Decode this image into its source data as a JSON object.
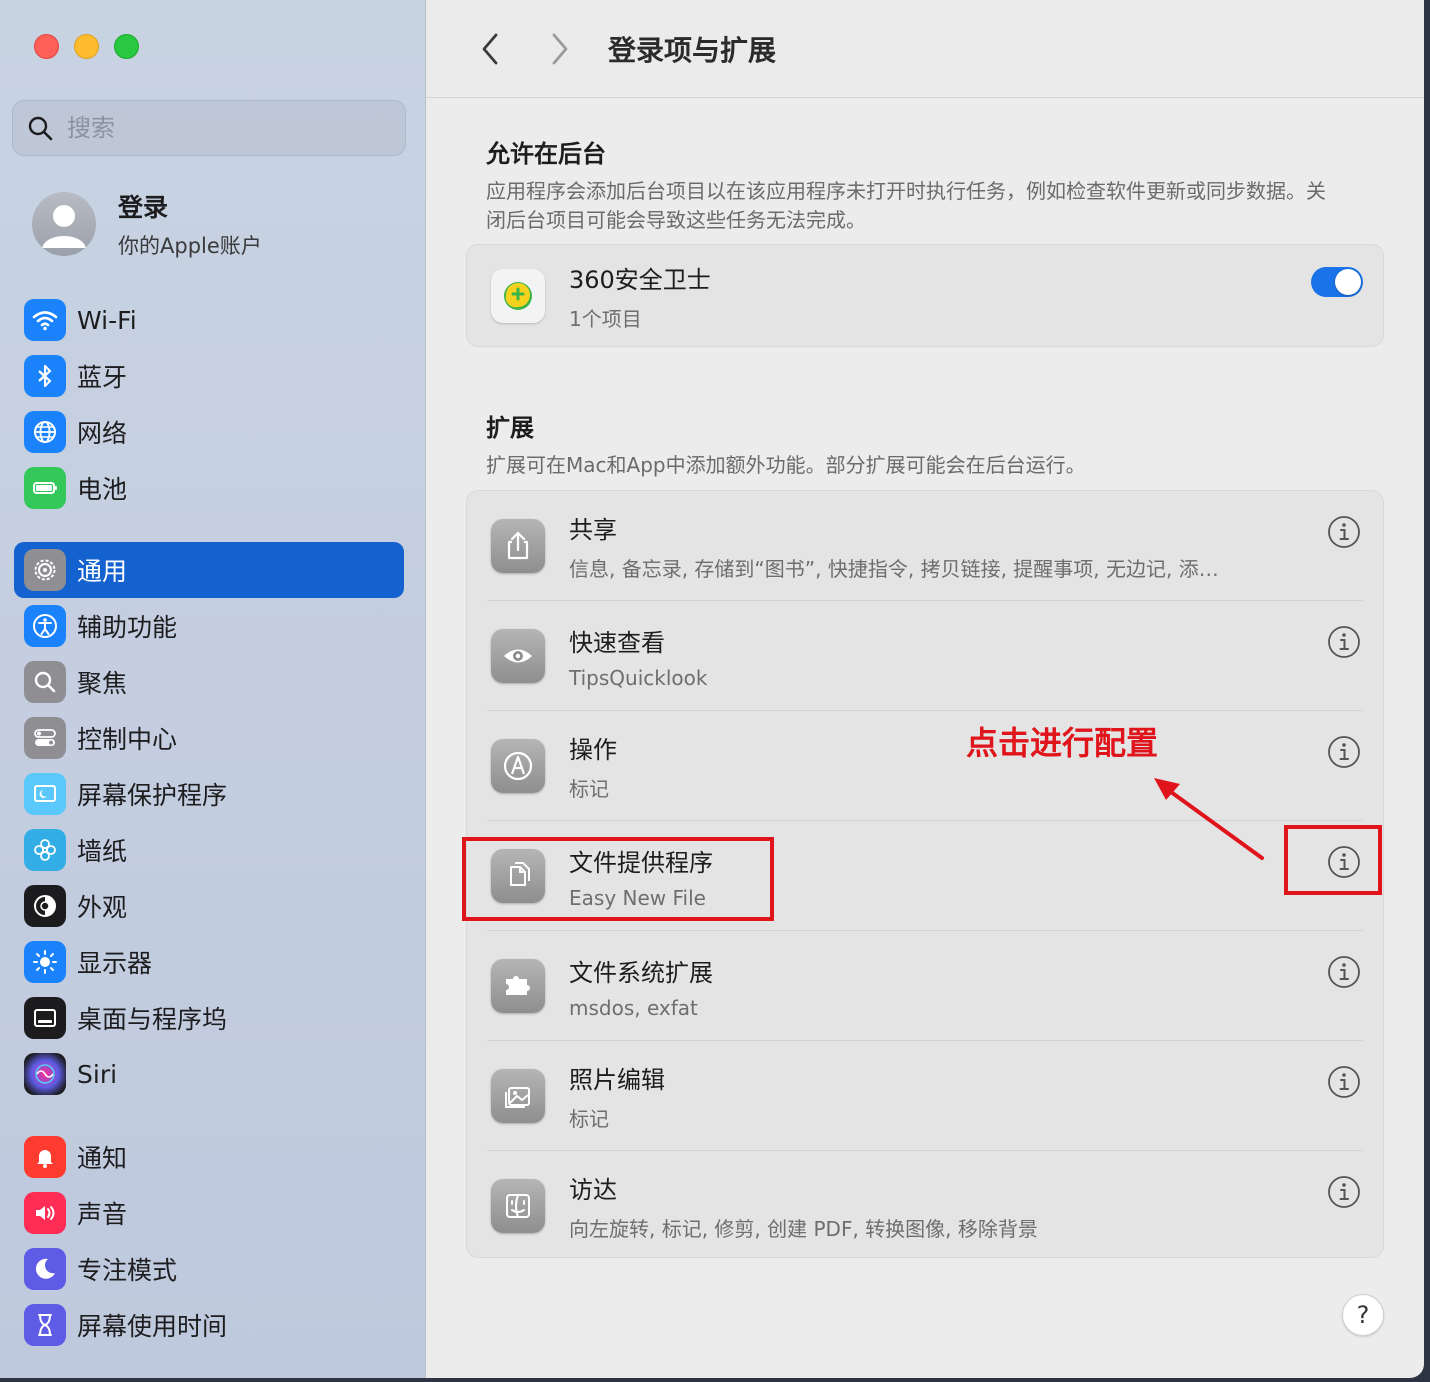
{
  "sidebar": {
    "search_placeholder": "搜索",
    "account": {
      "title": "登录",
      "subtitle": "你的Apple账户"
    },
    "groups": [
      [
        {
          "label": "Wi-Fi",
          "icon": "wifi-icon",
          "color": "#1a82fb"
        },
        {
          "label": "蓝牙",
          "icon": "bluetooth-icon",
          "color": "#1a82fb"
        },
        {
          "label": "网络",
          "icon": "globe-icon",
          "color": "#1a82fb"
        },
        {
          "label": "电池",
          "icon": "battery-icon",
          "color": "#34c759"
        }
      ],
      [
        {
          "label": "通用",
          "icon": "gear-icon",
          "color": "#8e8e93",
          "active": true
        },
        {
          "label": "辅助功能",
          "icon": "accessibility-icon",
          "color": "#1a82fb"
        },
        {
          "label": "聚焦",
          "icon": "spotlight-icon",
          "color": "#8e8e93"
        },
        {
          "label": "控制中心",
          "icon": "control-center-icon",
          "color": "#8e8e93"
        },
        {
          "label": "屏幕保护程序",
          "icon": "screensaver-icon",
          "color": "#5ac8fa"
        },
        {
          "label": "墙纸",
          "icon": "wallpaper-icon",
          "color": "#32ade6"
        },
        {
          "label": "外观",
          "icon": "appearance-icon",
          "color": "#1c1c1e"
        },
        {
          "label": "显示器",
          "icon": "display-icon",
          "color": "#1a82fb"
        },
        {
          "label": "桌面与程序坞",
          "icon": "dock-icon",
          "color": "#1c1c1e"
        },
        {
          "label": "Siri",
          "icon": "siri-icon",
          "color": "#1c1c1e"
        }
      ],
      [
        {
          "label": "通知",
          "icon": "notification-icon",
          "color": "#ff3b30"
        },
        {
          "label": "声音",
          "icon": "sound-icon",
          "color": "#ff2d55"
        },
        {
          "label": "专注模式",
          "icon": "focus-icon",
          "color": "#5e5ce6"
        },
        {
          "label": "屏幕使用时间",
          "icon": "screen-time-icon",
          "color": "#5e5ce6"
        }
      ]
    ]
  },
  "toolbar": {
    "title": "登录项与扩展"
  },
  "background": {
    "title": "允许在后台",
    "description": "应用程序会添加后台项目以在该应用程序未打开时执行任务，例如检查软件更新或同步数据。关闭后台项目可能会导致这些任务无法完成。",
    "item": {
      "title": "360安全卫士",
      "subtitle": "1个项目",
      "enabled": true
    }
  },
  "extensions": {
    "title": "扩展",
    "description": "扩展可在Mac和App中添加额外功能。部分扩展可能会在后台运行。",
    "items": [
      {
        "title": "共享",
        "subtitle": "信息, 备忘录, 存储到“图书”, 快捷指令, 拷贝链接, 提醒事项, 无边记, 添…",
        "icon": "share-icon"
      },
      {
        "title": "快速查看",
        "subtitle": "TipsQuicklook",
        "icon": "eye-icon"
      },
      {
        "title": "操作",
        "subtitle": "标记",
        "icon": "markup-icon"
      },
      {
        "title": "文件提供程序",
        "subtitle": "Easy New File",
        "icon": "file-provider-icon"
      },
      {
        "title": "文件系统扩展",
        "subtitle": "msdos, exfat",
        "icon": "puzzle-icon"
      },
      {
        "title": "照片编辑",
        "subtitle": "标记",
        "icon": "photo-icon"
      },
      {
        "title": "访达",
        "subtitle": "向左旋转, 标记, 修剪, 创建 PDF, 转换图像, 移除背景",
        "icon": "finder-icon"
      }
    ]
  },
  "annotation": {
    "text": "点击进行配置",
    "color": "#e0151b"
  },
  "help_label": "?"
}
